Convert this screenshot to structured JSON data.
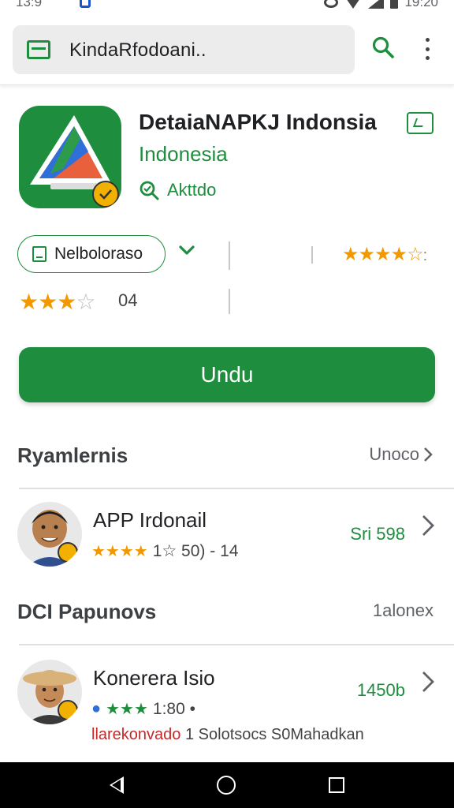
{
  "status_bar": {
    "time_left": "13:9",
    "time_right": "19:20"
  },
  "search": {
    "text": "KindaRfodoani.."
  },
  "app": {
    "title": "DetaiaNAPKJ Indonsia",
    "subtitle": "Indonesia",
    "meta": "Akttdo"
  },
  "ratings": {
    "chip_label": "Nelboloraso",
    "top_stars": "★★★★☆",
    "small_stars_filled": "★★★",
    "small_stars_empty": "☆",
    "count": "04"
  },
  "install": {
    "label": "Undu"
  },
  "sections": [
    {
      "title": "Ryamlernis",
      "link": "Unoco",
      "item": {
        "title": "APP Irdonail",
        "stars": "★★★★",
        "rating_text": "1☆ 50) - 14",
        "price": "Sri 598"
      }
    },
    {
      "title": "DCI Papunovs",
      "link": "1alonex",
      "item": {
        "title": "Konerera Isio",
        "stars": "★★★",
        "rating_text": "1:80 •",
        "price": "1450b",
        "note_red": "llarekonvado",
        "note_rest": " 1 Solotsocs S0Mahadkan"
      }
    }
  ],
  "colors": {
    "accent": "#1e8e3e",
    "star": "#f29900",
    "navbar": "#000000"
  }
}
